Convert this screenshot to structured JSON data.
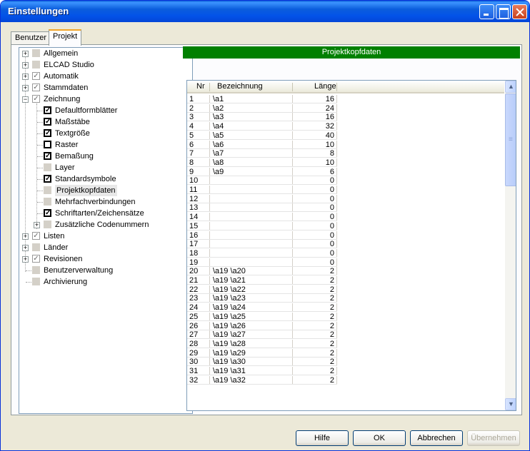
{
  "window": {
    "title": "Einstellungen"
  },
  "tabs": [
    {
      "label": "Benutzer"
    },
    {
      "label": "Projekt"
    }
  ],
  "tree": [
    {
      "label": "Allgemein",
      "expander": "+",
      "check": "grey"
    },
    {
      "label": "ELCAD Studio",
      "expander": "+",
      "check": "grey"
    },
    {
      "label": "Automatik",
      "expander": "+",
      "check": "checked-dim"
    },
    {
      "label": "Stammdaten",
      "expander": "+",
      "check": "checked-dim"
    },
    {
      "label": "Zeichnung",
      "expander": "−",
      "check": "checked-dim"
    },
    {
      "label": "Defaultformblätter",
      "check": "checked"
    },
    {
      "label": "Maßstäbe",
      "check": "checked"
    },
    {
      "label": "Textgröße",
      "check": "checked"
    },
    {
      "label": "Raster",
      "check": "unchecked"
    },
    {
      "label": "Bemaßung",
      "check": "checked"
    },
    {
      "label": "Layer",
      "check": "grey"
    },
    {
      "label": "Standardsymbole",
      "check": "checked"
    },
    {
      "label": "Projektkopfdaten",
      "check": "grey",
      "selected": true
    },
    {
      "label": "Mehrfachverbindungen",
      "check": "grey"
    },
    {
      "label": "Schriftarten/Zeichensätze",
      "check": "checked"
    },
    {
      "label": "Zusätzliche Codenummern",
      "expander": "+",
      "check": "grey"
    },
    {
      "label": "Listen",
      "expander": "+",
      "check": "checked-dim"
    },
    {
      "label": "Länder",
      "expander": "+",
      "check": "grey"
    },
    {
      "label": "Revisionen",
      "expander": "+",
      "check": "checked-dim"
    },
    {
      "label": "Benutzerverwaltung",
      "check": "grey"
    },
    {
      "label": "Archivierung",
      "check": "grey"
    }
  ],
  "section": {
    "title": "Projektkopfdaten"
  },
  "table": {
    "headers": [
      "Nr",
      "Bezeichnung",
      "Länge"
    ],
    "rows": [
      [
        "1",
        "\\a1",
        "16"
      ],
      [
        "2",
        "\\a2",
        "24"
      ],
      [
        "3",
        "\\a3",
        "16"
      ],
      [
        "4",
        "\\a4",
        "32"
      ],
      [
        "5",
        "\\a5",
        "40"
      ],
      [
        "6",
        "\\a6",
        "10"
      ],
      [
        "7",
        "\\a7",
        "8"
      ],
      [
        "8",
        "\\a8",
        "10"
      ],
      [
        "9",
        "\\a9",
        "6"
      ],
      [
        "10",
        "",
        "0"
      ],
      [
        "11",
        "",
        "0"
      ],
      [
        "12",
        "",
        "0"
      ],
      [
        "13",
        "",
        "0"
      ],
      [
        "14",
        "",
        "0"
      ],
      [
        "15",
        "",
        "0"
      ],
      [
        "16",
        "",
        "0"
      ],
      [
        "17",
        "",
        "0"
      ],
      [
        "18",
        "",
        "0"
      ],
      [
        "19",
        "",
        "0"
      ],
      [
        "20",
        "\\a19 \\a20",
        "2"
      ],
      [
        "21",
        "\\a19 \\a21",
        "2"
      ],
      [
        "22",
        "\\a19 \\a22",
        "2"
      ],
      [
        "23",
        "\\a19 \\a23",
        "2"
      ],
      [
        "24",
        "\\a19 \\a24",
        "2"
      ],
      [
        "25",
        "\\a19 \\a25",
        "2"
      ],
      [
        "26",
        "\\a19 \\a26",
        "2"
      ],
      [
        "27",
        "\\a19 \\a27",
        "2"
      ],
      [
        "28",
        "\\a19 \\a28",
        "2"
      ],
      [
        "29",
        "\\a19 \\a29",
        "2"
      ],
      [
        "30",
        "\\a19 \\a30",
        "2"
      ],
      [
        "31",
        "\\a19 \\a31",
        "2"
      ],
      [
        "32",
        "\\a19 \\a32",
        "2"
      ]
    ]
  },
  "buttons": {
    "help": "Hilfe",
    "ok": "OK",
    "cancel": "Abbrechen",
    "apply": "Übernehmen"
  }
}
